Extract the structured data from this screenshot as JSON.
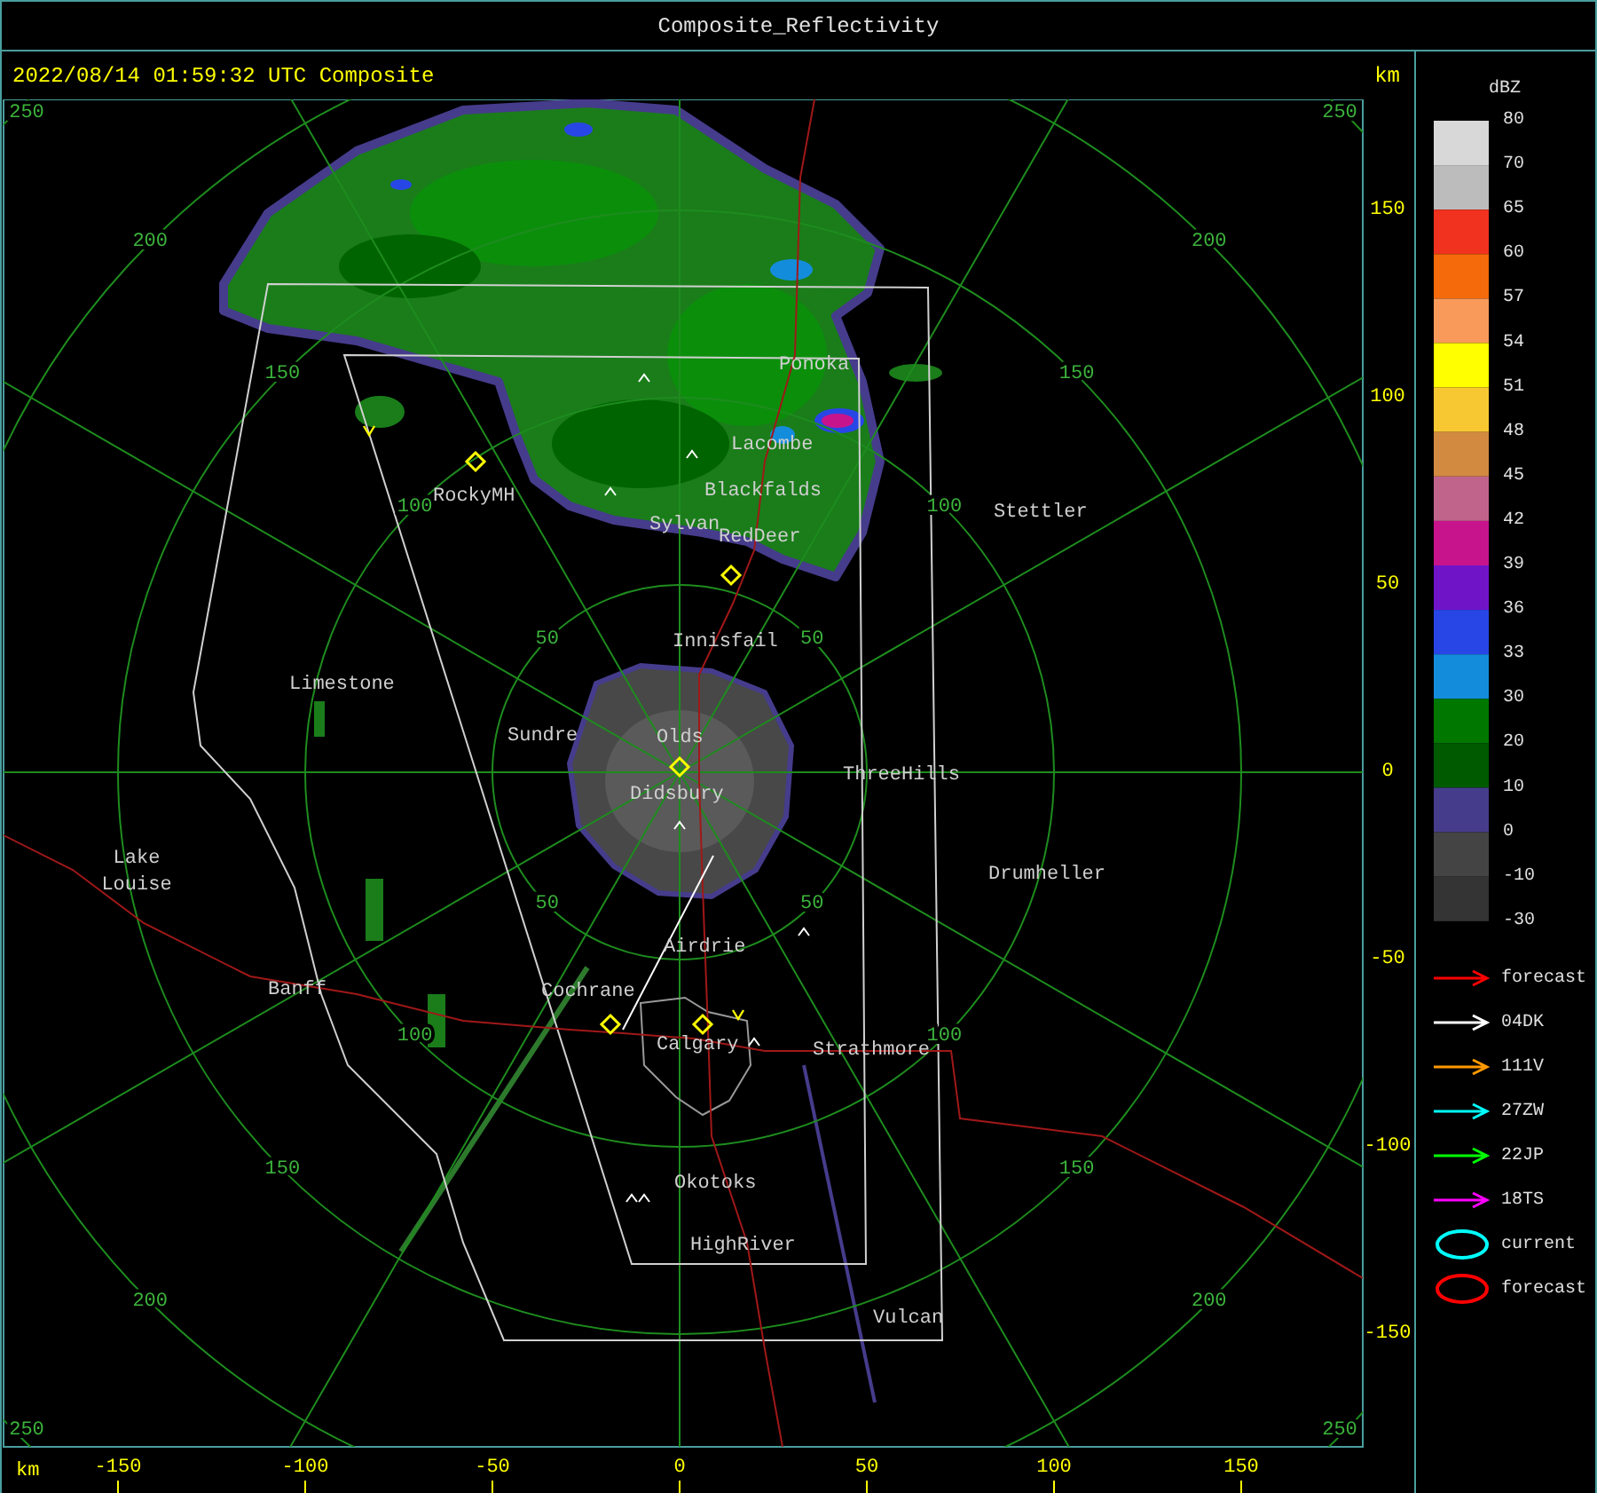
{
  "window": {
    "title": "Composite_Reflectivity"
  },
  "map": {
    "timestamp": "2022/08/14 01:59:32 UTC Composite",
    "corner_unit": "km",
    "range_rings": [
      {
        "labels": [
          "50",
          "50",
          "50",
          "50"
        ]
      },
      {
        "labels": [
          "100",
          "100",
          "100",
          "100"
        ]
      },
      {
        "labels": [
          "150",
          "150",
          "150",
          "150"
        ]
      },
      {
        "labels": [
          "200",
          "200",
          "200",
          "200"
        ]
      },
      {
        "labels": [
          "250",
          "250",
          "250",
          "250"
        ]
      }
    ],
    "places": [
      {
        "lines": [
          "Ponoka"
        ]
      },
      {
        "lines": [
          "Lacombe"
        ]
      },
      {
        "lines": [
          "Blackfalds"
        ]
      },
      {
        "lines": [
          "RockyMH"
        ]
      },
      {
        "lines": [
          "Stettler"
        ]
      },
      {
        "lines": [
          "Sylvan"
        ]
      },
      {
        "lines": [
          "RedDeer"
        ]
      },
      {
        "lines": [
          "Innisfail"
        ]
      },
      {
        "lines": [
          "Limestone"
        ]
      },
      {
        "lines": [
          "Sundre"
        ]
      },
      {
        "lines": [
          "Olds"
        ]
      },
      {
        "lines": [
          "ThreeHills"
        ]
      },
      {
        "lines": [
          "Didsbury"
        ]
      },
      {
        "lines": [
          "Lake",
          "Louise"
        ]
      },
      {
        "lines": [
          "Drumheller"
        ]
      },
      {
        "lines": [
          "Airdrie"
        ]
      },
      {
        "lines": [
          "Banff"
        ]
      },
      {
        "lines": [
          "Cochrane"
        ]
      },
      {
        "lines": [
          "Calgary"
        ]
      },
      {
        "lines": [
          "Strathmore"
        ]
      },
      {
        "lines": [
          "Okotoks"
        ]
      },
      {
        "lines": [
          "HighRiver"
        ]
      },
      {
        "lines": [
          "Vulcan"
        ]
      }
    ],
    "y_axis": {
      "ticks": [
        "150",
        "100",
        "50",
        "0",
        "-50",
        "-100",
        "-150"
      ]
    },
    "x_axis": {
      "unit": "km",
      "ticks": [
        "-150",
        "-100",
        "-50",
        "0",
        "50",
        "100",
        "150"
      ]
    }
  },
  "legend": {
    "unit": "dBZ",
    "bins": [
      {
        "color": "#d8d8d8"
      },
      {
        "color": "#bcbcbc"
      },
      {
        "color": "#f0321e"
      },
      {
        "color": "#f56a0a"
      },
      {
        "color": "#fa9a5a"
      },
      {
        "color": "#ffff00"
      },
      {
        "color": "#f8c832"
      },
      {
        "color": "#d18a40"
      },
      {
        "color": "#c0648c"
      },
      {
        "color": "#c8148c"
      },
      {
        "color": "#7014c8"
      },
      {
        "color": "#2846e6"
      },
      {
        "color": "#148cdc"
      },
      {
        "color": "#007800"
      },
      {
        "color": "#005a00"
      },
      {
        "color": "#463c8c"
      },
      {
        "color": "#444444"
      },
      {
        "color": "#343434"
      }
    ],
    "labels": [
      "80",
      "70",
      "65",
      "60",
      "57",
      "54",
      "51",
      "48",
      "45",
      "42",
      "39",
      "36",
      "33",
      "30",
      "20",
      "10",
      "0",
      "-10",
      "-30"
    ],
    "tracks": [
      {
        "kind": "arrow",
        "color": "#ff0000",
        "label": "forecast"
      },
      {
        "kind": "arrow",
        "color": "#ffffff",
        "label": "04DK"
      },
      {
        "kind": "arrow",
        "color": "#ff9900",
        "label": "111V"
      },
      {
        "kind": "arrow",
        "color": "#00ffff",
        "label": "27ZW"
      },
      {
        "kind": "arrow",
        "color": "#00ff00",
        "label": "22JP"
      },
      {
        "kind": "arrow",
        "color": "#ff00ff",
        "label": "18TS"
      },
      {
        "kind": "ellipse",
        "color": "#00ffff",
        "label": "current"
      },
      {
        "kind": "ellipse",
        "color": "#ff0000",
        "label": "forecast"
      }
    ]
  }
}
